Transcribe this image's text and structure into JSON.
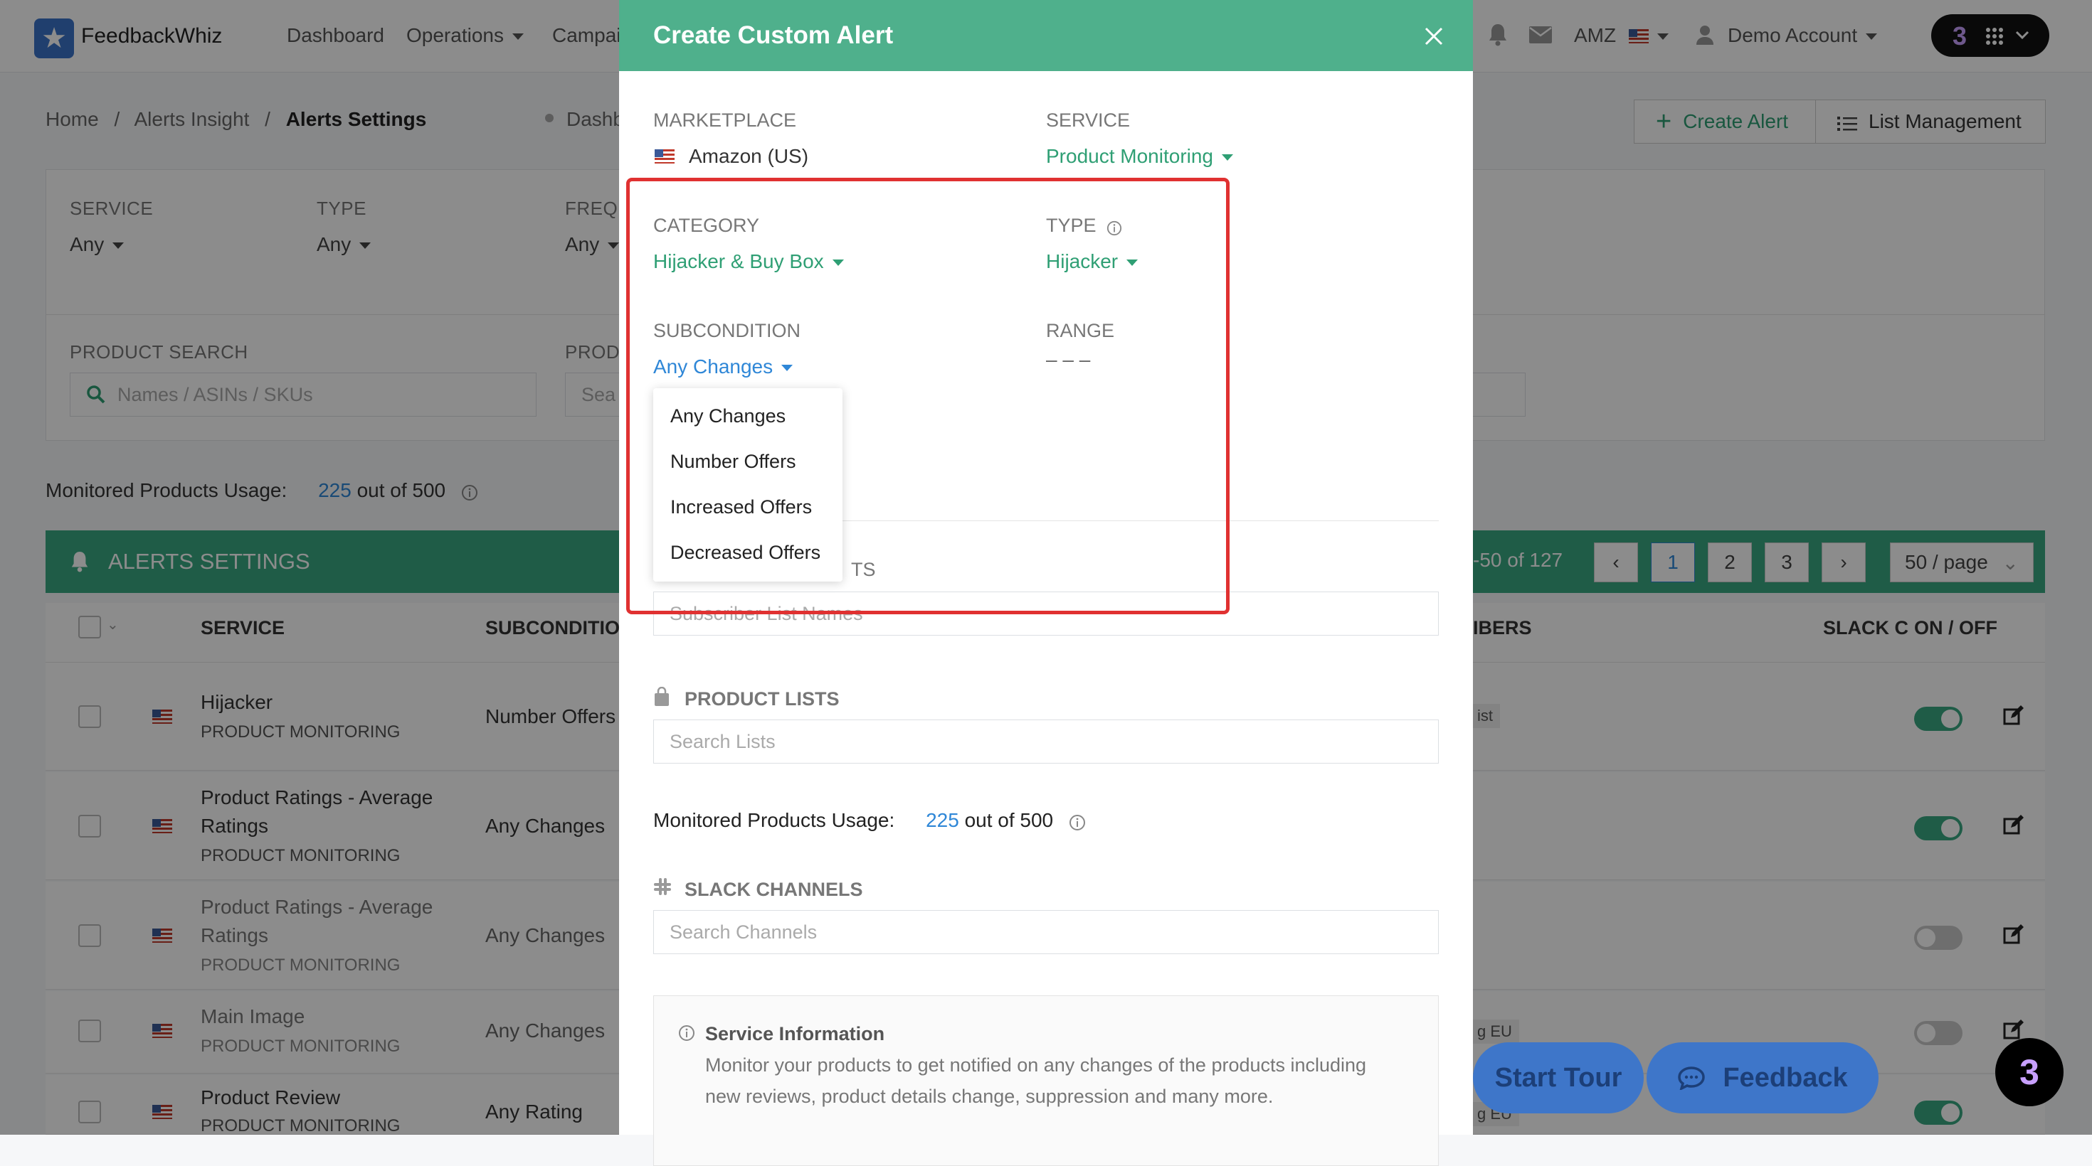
{
  "app": {
    "name": "FeedbackWhiz"
  },
  "nav": {
    "items": [
      "Dashboard",
      "Operations",
      "Campai"
    ],
    "marketplace": "AMZ",
    "account": "Demo Account"
  },
  "breadcrumb": {
    "home": "Home",
    "sep": "/",
    "section": "Alerts Insight",
    "current": "Alerts Settings",
    "extra": "Dashb"
  },
  "actions": {
    "create_alert": "Create Alert",
    "list_management": "List Management"
  },
  "filters": {
    "service_label": "SERVICE",
    "service_value": "Any",
    "type_label": "TYPE",
    "type_value": "Any",
    "freq_label": "FREQ",
    "freq_value": "Any",
    "product_search_label": "PRODUCT SEARCH",
    "product_search_placeholder": "Names / ASINs / SKUs",
    "prod_label": "PROD",
    "prod_placeholder": "Sea"
  },
  "usage": {
    "label": "Monitored Products Usage:",
    "used": "225",
    "rest": "out of 500"
  },
  "table": {
    "title": "ALERTS SETTINGS",
    "range": "-50 of 127",
    "pages": [
      "1",
      "2",
      "3"
    ],
    "page_size": "50 / page",
    "columns": {
      "service": "SERVICE",
      "subcondition": "SUBCONDITION",
      "subscribers": "IBERS",
      "slack": "SLACK C",
      "onoff": "ON / OFF"
    },
    "rows": [
      {
        "service": "Hijacker",
        "sub": "PRODUCT MONITORING",
        "subcondition": "Number Offers",
        "extra": "ist",
        "on": true,
        "muted": false
      },
      {
        "service": "Product Ratings - Average",
        "service2": "Ratings",
        "sub": "PRODUCT MONITORING",
        "subcondition": "Any Changes",
        "on": true,
        "muted": false
      },
      {
        "service": "Product Ratings - Average",
        "service2": "Ratings",
        "sub": "PRODUCT MONITORING",
        "subcondition": "Any Changes",
        "on": false,
        "muted": true
      },
      {
        "service": "Main Image",
        "sub": "PRODUCT MONITORING",
        "subcondition": "Any Changes",
        "extra": "g EU",
        "on": false,
        "muted": true
      },
      {
        "service": "Product Review",
        "sub": "PRODUCT MONITORING",
        "subcondition": "Any Rating",
        "extra": "g EU",
        "on": true,
        "muted": false
      }
    ]
  },
  "modal": {
    "title": "Create Custom Alert",
    "marketplace_label": "MARKETPLACE",
    "marketplace_value": "Amazon (US)",
    "service_label": "SERVICE",
    "service_value": "Product Monitoring",
    "category_label": "CATEGORY",
    "category_value": "Hijacker & Buy Box",
    "type_label": "TYPE",
    "type_value": "Hijacker",
    "subcondition_label": "SUBCONDITION",
    "subcondition_value": "Any Changes",
    "range_label": "RANGE",
    "range_value": "– – –",
    "subscriber_label_tail": "TS",
    "subscriber_placeholder": "Subscriber List Names",
    "product_lists_label": "PRODUCT LISTS",
    "product_lists_placeholder": "Search Lists",
    "usage_label": "Monitored Products Usage:",
    "usage_used": "225",
    "usage_rest": "out of 500",
    "slack_label": "SLACK CHANNELS",
    "slack_placeholder": "Search Channels",
    "info_title": "Service Information",
    "info_line1": "Monitor your products to get notified on any changes of the products including",
    "info_line2": "new reviews, product details change, suppression and many more."
  },
  "dropdown": {
    "options": [
      "Any Changes",
      "Number Offers",
      "Increased Offers",
      "Decreased Offers"
    ]
  },
  "floating": {
    "start_tour": "Start Tour",
    "feedback": "Feedback"
  },
  "colors": {
    "brand_green": "#4fb08c",
    "link_green": "#2f9f74",
    "usage_blue": "#2f87d7",
    "highlight_red": "#e03131"
  }
}
